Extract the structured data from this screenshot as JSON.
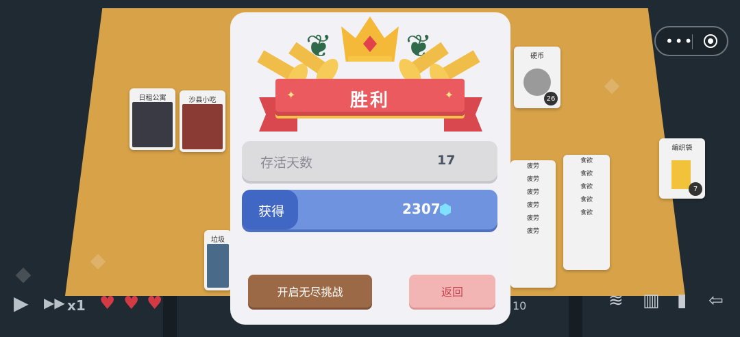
{
  "background": {
    "cards": {
      "apartment": "日租公寓",
      "snack_shop": "沙县小吃",
      "coin": "硬币",
      "coin_count": "26",
      "garbage": "垃圾",
      "fatigue_lines": [
        "疲劳",
        "疲劳",
        "疲劳",
        "疲劳",
        "疲劳",
        "疲劳"
      ],
      "food_lines": [
        "食欲",
        "食欲",
        "食欲",
        "食欲",
        "食欲"
      ],
      "bag": "编织袋",
      "bag_count": "7"
    },
    "hud": {
      "speed": "x1",
      "weight": "10",
      "hearts": 3
    }
  },
  "modal": {
    "title": "胜利",
    "survive_label": "存活天数",
    "survive_value": "17",
    "earn_label": "获得",
    "earn_value": "2307",
    "endless_button": "开启无尽挑战",
    "back_button": "返回"
  },
  "colors": {
    "ribbon": "#ea5a5f",
    "earn_row": "#6f93df",
    "endless_button": "#9c6947",
    "back_button": "#f3b4b4"
  }
}
